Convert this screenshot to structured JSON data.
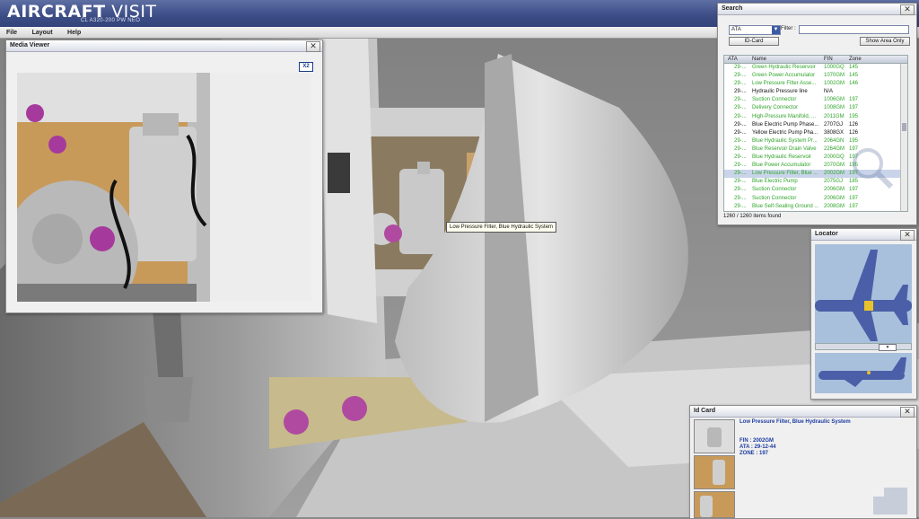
{
  "app": {
    "title_bold": "AIRCRAFT",
    "title_light": " VISIT",
    "subtitle": "CL A320-200 PW NEO"
  },
  "menu": [
    "File",
    "Layout",
    "Help"
  ],
  "media_viewer": {
    "title": "Media Viewer",
    "zoom_button": "X2",
    "close_glyph": "✕"
  },
  "search": {
    "title": "Search",
    "select_value": "ATA",
    "filter_label": "Filter :",
    "filter_value": "",
    "idcard_button": "ID-Card",
    "show_area_button": "Show Area Only",
    "columns": [
      "ATA",
      "Name",
      "FIN",
      "Zone"
    ],
    "rows": [
      {
        "ata": "29-...",
        "name": "Green Hydraulic Reservoir",
        "fin": "1000GQ",
        "zone": "145",
        "style": "g"
      },
      {
        "ata": "29-...",
        "name": "Green Power Accumulator",
        "fin": "1070GM",
        "zone": "145",
        "style": "g"
      },
      {
        "ata": "29-...",
        "name": "Low Pressure Filter Asse...",
        "fin": "1002GM",
        "zone": "146",
        "style": "g"
      },
      {
        "ata": "29-...",
        "name": "Hydraulic Pressure line",
        "fin": "N/A",
        "zone": "",
        "style": "k"
      },
      {
        "ata": "29-...",
        "name": "Suction Connector",
        "fin": "1006GM",
        "zone": "197",
        "style": "g"
      },
      {
        "ata": "29-...",
        "name": "Delivery Connector",
        "fin": "1008GM",
        "zone": "197",
        "style": "g"
      },
      {
        "ata": "29-...",
        "name": "High-Pressure Manifold, ...",
        "fin": "2011GM",
        "zone": "195",
        "style": "g"
      },
      {
        "ata": "29-...",
        "name": "Blue Electric Pump Phase...",
        "fin": "2707GJ",
        "zone": "126",
        "style": "k"
      },
      {
        "ata": "29-...",
        "name": "Yellow Electric Pump Pha...",
        "fin": "3808GX",
        "zone": "126",
        "style": "k"
      },
      {
        "ata": "29-...",
        "name": "Blue Hydraulic System Pr...",
        "fin": "2064GN",
        "zone": "195",
        "style": "g"
      },
      {
        "ata": "29-...",
        "name": "Blue Reservoir Drain Valve",
        "fin": "2264GM",
        "zone": "197",
        "style": "g"
      },
      {
        "ata": "29-...",
        "name": "Blue Hydraulic Reservoir",
        "fin": "2000GQ",
        "zone": "197",
        "style": "g"
      },
      {
        "ata": "29-...",
        "name": "Blue Power Accumulator",
        "fin": "2070GM",
        "zone": "195",
        "style": "g"
      },
      {
        "ata": "29-...",
        "name": "Low Pressure Filter, Blue ...",
        "fin": "2002GM",
        "zone": "197",
        "style": "sel"
      },
      {
        "ata": "29-...",
        "name": "Blue Electric Pump",
        "fin": "2075GJ",
        "zone": "185",
        "style": "g"
      },
      {
        "ata": "29-...",
        "name": "Suction Connector",
        "fin": "2006GM",
        "zone": "197",
        "style": "g"
      },
      {
        "ata": "29-...",
        "name": "Suction Connector",
        "fin": "2006GM",
        "zone": "197",
        "style": "g"
      },
      {
        "ata": "29-...",
        "name": "Blue Self-Sealing Ground ...",
        "fin": "2008GM",
        "zone": "197",
        "style": "g"
      }
    ],
    "items_found": "1260 / 1260 items found"
  },
  "locator": {
    "title": "Locator"
  },
  "id_card": {
    "title": "Id Card",
    "item_name": "Low Pressure Filter, Blue Hydraulic System",
    "fin": "FIN : 2002GM",
    "ata": "ATA : 29-12-44",
    "zone": "ZONE : 197"
  },
  "tooltip": "Low Pressure Filter, Blue Hydraulic System",
  "colors": {
    "brand_blue": "#3b4c86",
    "list_green": "#2fa52a",
    "id_blue": "#1d3da0",
    "locator_highlight": "#e8c22a"
  }
}
